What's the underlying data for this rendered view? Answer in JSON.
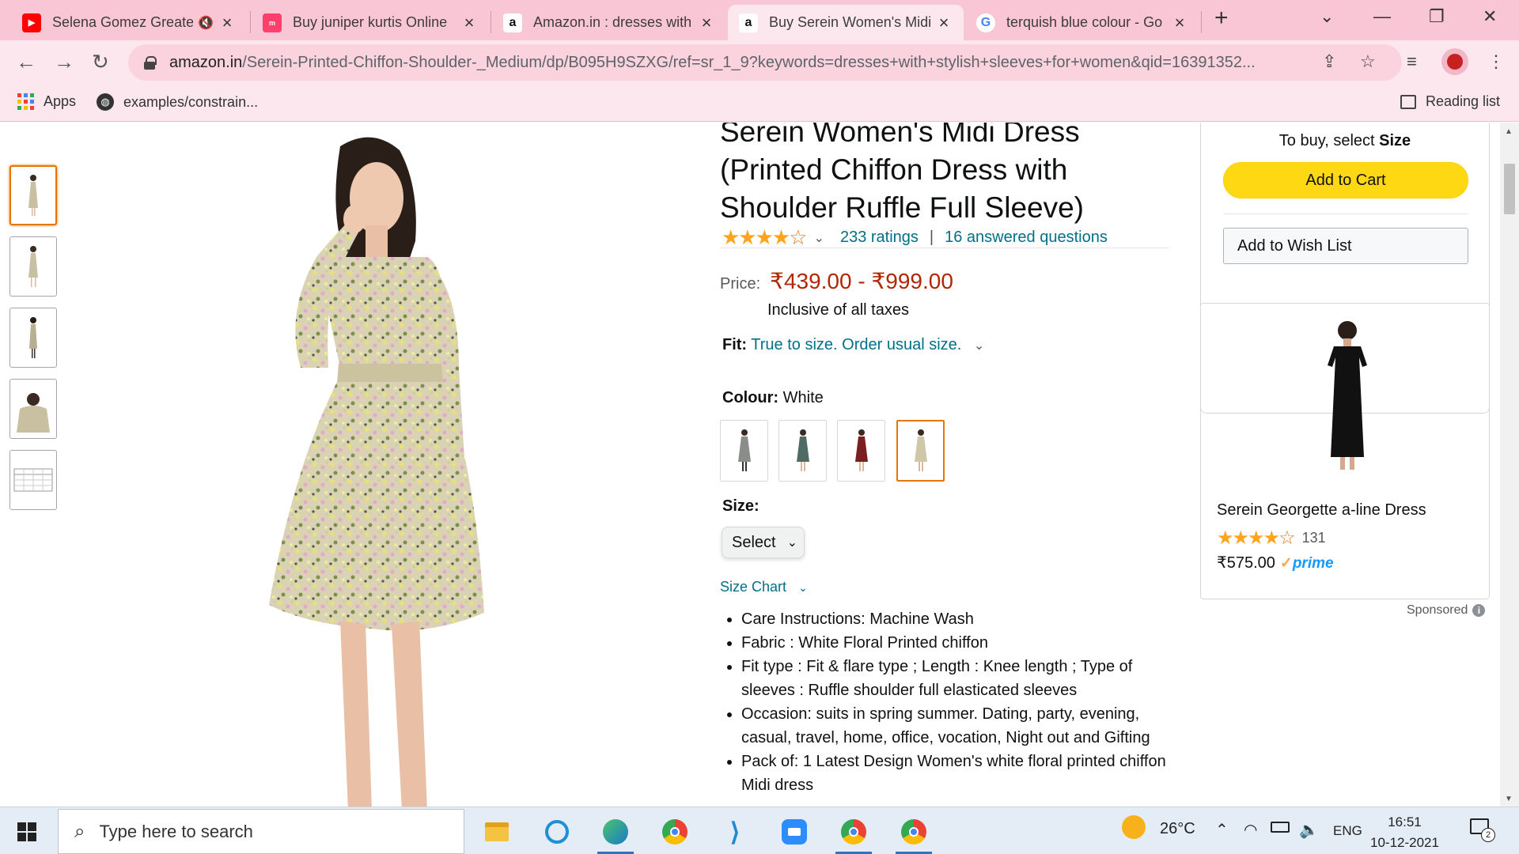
{
  "browser": {
    "tabs": [
      {
        "title": "Selena Gomez Greate",
        "favicon": "youtube-icon",
        "muted": true
      },
      {
        "title": "Buy juniper kurtis Online",
        "favicon": "myntra-icon"
      },
      {
        "title": "Amazon.in : dresses with",
        "favicon": "amazon-icon"
      },
      {
        "title": "Buy Serein Women's Midi",
        "favicon": "amazon-icon",
        "active": true
      },
      {
        "title": "terquish blue colour - Go",
        "favicon": "google-icon"
      }
    ],
    "url_host": "amazon.in",
    "url_path": "/Serein-Printed-Chiffon-Shoulder-_Medium/dp/B095H9SZXG/ref=sr_1_9?keywords=dresses+with+stylish+sleeves+for+women&qid=16391352...",
    "bookmarks": {
      "apps": "Apps",
      "bookmark1": "examples/constrain...",
      "reading_list": "Reading list"
    },
    "colors": {
      "tabstrip": "#f9c6d6",
      "toolbar": "#fde7ee"
    }
  },
  "product": {
    "title": "Serein Women's Midi Dress (Printed Chiffon Dress with Shoulder Ruffle Full Sleeve)",
    "rating": 3.5,
    "ratings_text": "233 ratings",
    "separator": "|",
    "questions_text": "16 answered questions",
    "price_label": "Price:",
    "price": "₹439.00 - ₹999.00",
    "taxes": "Inclusive of all taxes",
    "fit_label": "Fit:",
    "fit_value": "True to size. Order usual size.",
    "colour_label": "Colour:",
    "colour_value": "White",
    "swatches": [
      "grey",
      "teal",
      "maroon",
      "white"
    ],
    "selected_swatch": 3,
    "size_label": "Size:",
    "size_select": "Select",
    "size_chart": "Size Chart",
    "bullets": [
      "Care Instructions: Machine Wash",
      "Fabric : White Floral Printed chiffon",
      "Fit type : Fit & flare type ; Length : Knee length ; Type of sleeves : Ruffle shoulder full elasticated sleeves",
      "Occasion: suits in spring summer. Dating, party, evening, casual, travel, home, office, vocation, Night out and Gifting",
      "Pack of: 1 Latest Design Women's white floral printed chiffon Midi dress"
    ]
  },
  "buybox": {
    "to_buy_prefix": "To buy, select ",
    "to_buy_bold": "Size",
    "add_to_cart": "Add to Cart",
    "add_to_wishlist": "Add to Wish List"
  },
  "ad": {
    "title": "Serein Georgette a-line Dress",
    "rating": 3.5,
    "rating_count": "131",
    "price": "₹575.00",
    "prime": "prime",
    "sponsored": "Sponsored"
  },
  "taskbar": {
    "search_placeholder": "Type here to search",
    "weather": "26°C",
    "lang": "ENG",
    "time": "16:51",
    "date": "10-12-2021",
    "notification_count": "2"
  }
}
